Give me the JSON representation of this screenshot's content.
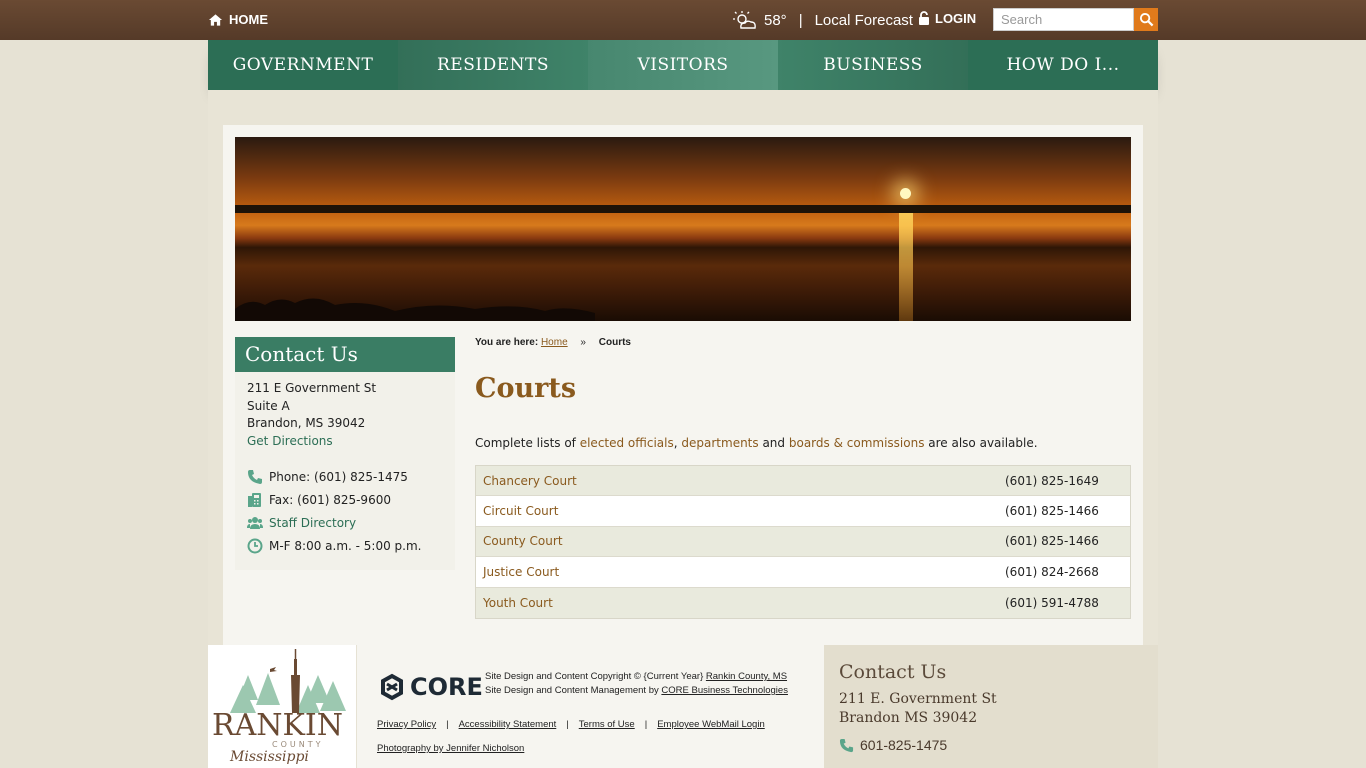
{
  "topbar": {
    "home_label": "HOME",
    "temperature": "58°",
    "forecast_label": "Local Forecast",
    "login_label": "LOGIN",
    "search_placeholder": "Search"
  },
  "nav": {
    "items": [
      "GOVERNMENT",
      "RESIDENTS",
      "VISITORS",
      "BUSINESS",
      "HOW DO I..."
    ]
  },
  "sidebar": {
    "heading": "Contact Us",
    "address": [
      "211 E Government St",
      "Suite A",
      "Brandon, MS 39042"
    ],
    "directions_label": "Get Directions",
    "phone": "Phone: (601) 825-1475",
    "fax": "Fax: (601) 825-9600",
    "staff_directory": "Staff Directory",
    "hours": "M-F 8:00 a.m. - 5:00 p.m."
  },
  "breadcrumb": {
    "prefix": "You are here:",
    "home": "Home",
    "arrow": "»",
    "current": "Courts"
  },
  "page": {
    "title": "Courts",
    "intro": {
      "t1": "Complete lists of ",
      "link1": "elected officials",
      "t2": ", ",
      "link2": "departments",
      "t3": " and ",
      "link3": "boards & commissions",
      "t4": " are also available."
    },
    "courts": [
      {
        "name": "Chancery Court",
        "phone": "(601) 825-1649"
      },
      {
        "name": "Circuit Court",
        "phone": "(601) 825-1466"
      },
      {
        "name": "County Court",
        "phone": "(601) 825-1466"
      },
      {
        "name": "Justice Court",
        "phone": "(601) 824-2668"
      },
      {
        "name": "Youth Court",
        "phone": "(601) 591-4788"
      }
    ]
  },
  "footer": {
    "core_label": "CORE",
    "copyright_line1_text": "Site Design and Content Copyright © {Current Year} ",
    "copyright_line1_link": "Rankin County, MS",
    "copyright_line2_text": "Site Design and Content Management by ",
    "copyright_line2_link": "CORE Business Technologies",
    "links": [
      "Privacy Policy",
      "Accessibility Statement",
      "Terms of Use",
      "Employee WebMail Login"
    ],
    "photo_credit": "Photography by Jennifer Nicholson",
    "logo_main": "RANKIN",
    "logo_sub": "COUNTY",
    "logo_script": "Mississippi",
    "contact_heading": "Contact Us",
    "contact_address": [
      "211 E. Government St",
      "Brandon MS 39042"
    ],
    "contact_phone": "601-825-1475"
  },
  "colors": {
    "topbar": "#5e412d",
    "nav_green": "#2c6e55",
    "accent_orange": "#e07a1b",
    "link_brown": "#8a5a1e"
  }
}
